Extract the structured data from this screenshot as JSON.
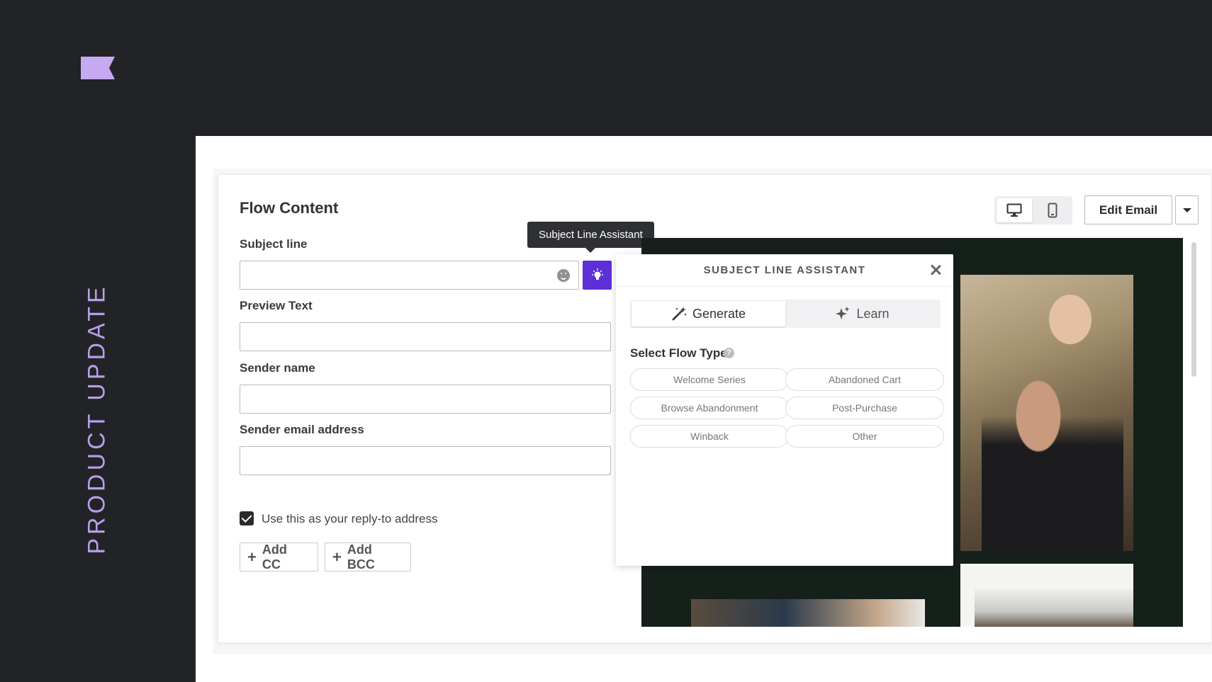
{
  "brand": {
    "logo_color": "#c6a9f0"
  },
  "side_label": "PRODUCT UPDATE",
  "flow": {
    "title": "Flow Content",
    "subject_label": "Subject line",
    "subject_value": "",
    "preview_label": "Preview Text",
    "preview_value": "",
    "sender_name_label": "Sender name",
    "sender_name_value": "",
    "sender_email_label": "Sender email address",
    "sender_email_value": "",
    "reply_to_label": "Use this as your reply-to address",
    "reply_to_checked": true,
    "add_cc_label": "Add CC",
    "add_bcc_label": "Add BCC"
  },
  "tooltip": "Subject Line Assistant",
  "toolbar": {
    "edit_email_label": "Edit Email",
    "device_active": "desktop"
  },
  "assistant": {
    "title": "SUBJECT LINE ASSISTANT",
    "tabs": [
      {
        "label": "Generate",
        "icon": "magic-wand-icon",
        "active": true
      },
      {
        "label": "Learn",
        "icon": "sparkle-icon",
        "active": false
      }
    ],
    "flow_type_label": "Select Flow Type",
    "flow_types": [
      "Welcome Series",
      "Abandoned Cart",
      "Browse Abandonment",
      "Post-Purchase",
      "Winback",
      "Other"
    ]
  },
  "colors": {
    "accent": "#5d2fd6",
    "side_text": "#b89de8",
    "background": "#222326"
  }
}
